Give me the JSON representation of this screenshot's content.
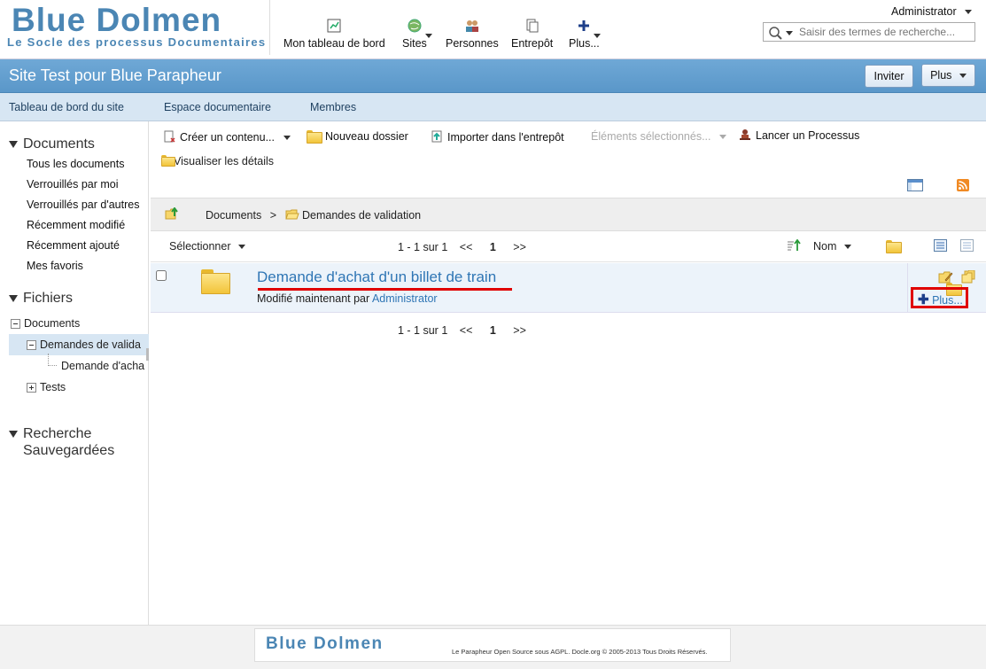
{
  "header": {
    "logo_title": "Blue Dolmen",
    "logo_subtitle": "Le Socle des processus Documentaires",
    "nav": [
      {
        "label": "Mon tableau de bord",
        "icon": "dashboard-icon"
      },
      {
        "label": "Sites",
        "icon": "sites-globe-icon"
      },
      {
        "label": "Personnes",
        "icon": "people-icon"
      },
      {
        "label": "Entrepôt",
        "icon": "repository-icon"
      },
      {
        "label": "Plus...",
        "icon": "plus-icon"
      }
    ],
    "user": "Administrator",
    "search_placeholder": "Saisir des termes de recherche..."
  },
  "titlebar": {
    "site_title": "Site Test pour Blue Parapheur",
    "invite_label": "Inviter",
    "more_label": "Plus"
  },
  "subnav": [
    "Tableau de bord du site",
    "Espace documentaire",
    "Membres"
  ],
  "sidebar": {
    "documents_heading": "Documents",
    "documents_links": [
      "Tous les documents",
      "Verrouillés par moi",
      "Verrouillés par d'autres",
      "Récemment modifié",
      "Récemment ajouté",
      "Mes favoris"
    ],
    "files_heading": "Fichiers",
    "tree": {
      "root": "Documents",
      "selected": "Demandes de valida",
      "child": "Demande d'acha",
      "sibling": "Tests"
    },
    "saved_search_heading_line1": "Recherche",
    "saved_search_heading_line2": "Sauvegardées"
  },
  "toolbar": {
    "create": "Créer un contenu...",
    "new_folder": "Nouveau dossier",
    "import": "Importer dans l'entrepôt",
    "selected_items": "Éléments sélectionnés...",
    "launch_process": "Lancer un Processus",
    "view_details": "Visualiser les détails"
  },
  "breadcrumb": {
    "root": "Documents",
    "sep": ">",
    "current": "Demandes de validation"
  },
  "listing": {
    "select_label": "Sélectionner",
    "pagination": "1 - 1 sur 1",
    "prev": "<<",
    "page": "1",
    "next": ">>",
    "sort_label": "Nom"
  },
  "row": {
    "title": "Demande d'achat d'un billet de train",
    "modified_prefix": "Modifié maintenant par",
    "modified_by": "Administrator",
    "more_action": "Plus..."
  },
  "footer": {
    "logo": "Blue Dolmen",
    "text": "Le Parapheur Open Source sous AGPL. Docle.org © 2005-2013 Tous Droits Réservés."
  },
  "colors": {
    "accent": "#5a97c9",
    "link": "#2f76b5",
    "highlight_red": "#e00000"
  }
}
